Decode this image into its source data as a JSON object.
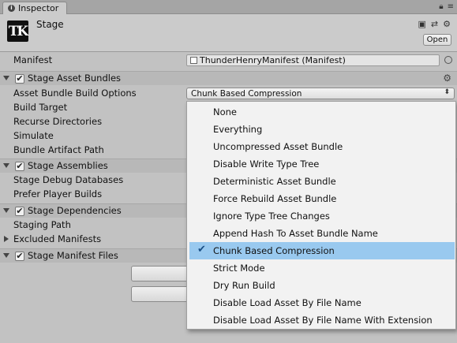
{
  "window": {
    "tab_label": "Inspector",
    "tab_icon": "info-icon",
    "lock_icon": "lock-icon",
    "menu_icon": "menu-icon"
  },
  "header": {
    "asset_title": "Stage",
    "asset_icon_text": "TK",
    "open_label": "Open",
    "icons": [
      "help-book-icon",
      "preset-icon",
      "settings-icon"
    ]
  },
  "manifest": {
    "label": "Manifest",
    "value": "ThunderHenryManifest (Manifest)"
  },
  "sections": {
    "asset_bundles": {
      "label": "Stage Asset Bundles",
      "checkmark": "✔",
      "gear": "⚙",
      "build_options_label": "Asset Bundle Build Options",
      "build_options_value": "Chunk Based Compression",
      "popup_arrow": "⬍",
      "rows": [
        "Build Target",
        "Recurse Directories",
        "Simulate",
        "Bundle Artifact Path"
      ]
    },
    "assemblies": {
      "label": "Stage Assemblies",
      "checkmark": "✔",
      "rows": [
        "Stage Debug Databases",
        "Prefer Player Builds"
      ]
    },
    "dependencies": {
      "label": "Stage Dependencies",
      "checkmark": "✔",
      "rows": [
        "Staging Path"
      ],
      "excluded_label": "Excluded Manifests"
    },
    "manifest_files": {
      "label": "Stage Manifest Files",
      "checkmark": "✔"
    }
  },
  "dropdown": {
    "check_glyph": "✔",
    "selected_index": 8,
    "options": [
      "None",
      "Everything",
      "Uncompressed Asset Bundle",
      "Disable Write Type Tree",
      "Deterministic Asset Bundle",
      "Force Rebuild Asset Bundle",
      "Ignore Type Tree Changes",
      "Append Hash To Asset Bundle Name",
      "Chunk Based Compression",
      "Strict Mode",
      "Dry Run Build",
      "Disable Load Asset By File Name",
      "Disable Load Asset By File Name With Extension"
    ]
  },
  "colors": {
    "selection": "#99c9ef",
    "panel": "#c2c2c2",
    "header": "#cbcbcb"
  }
}
